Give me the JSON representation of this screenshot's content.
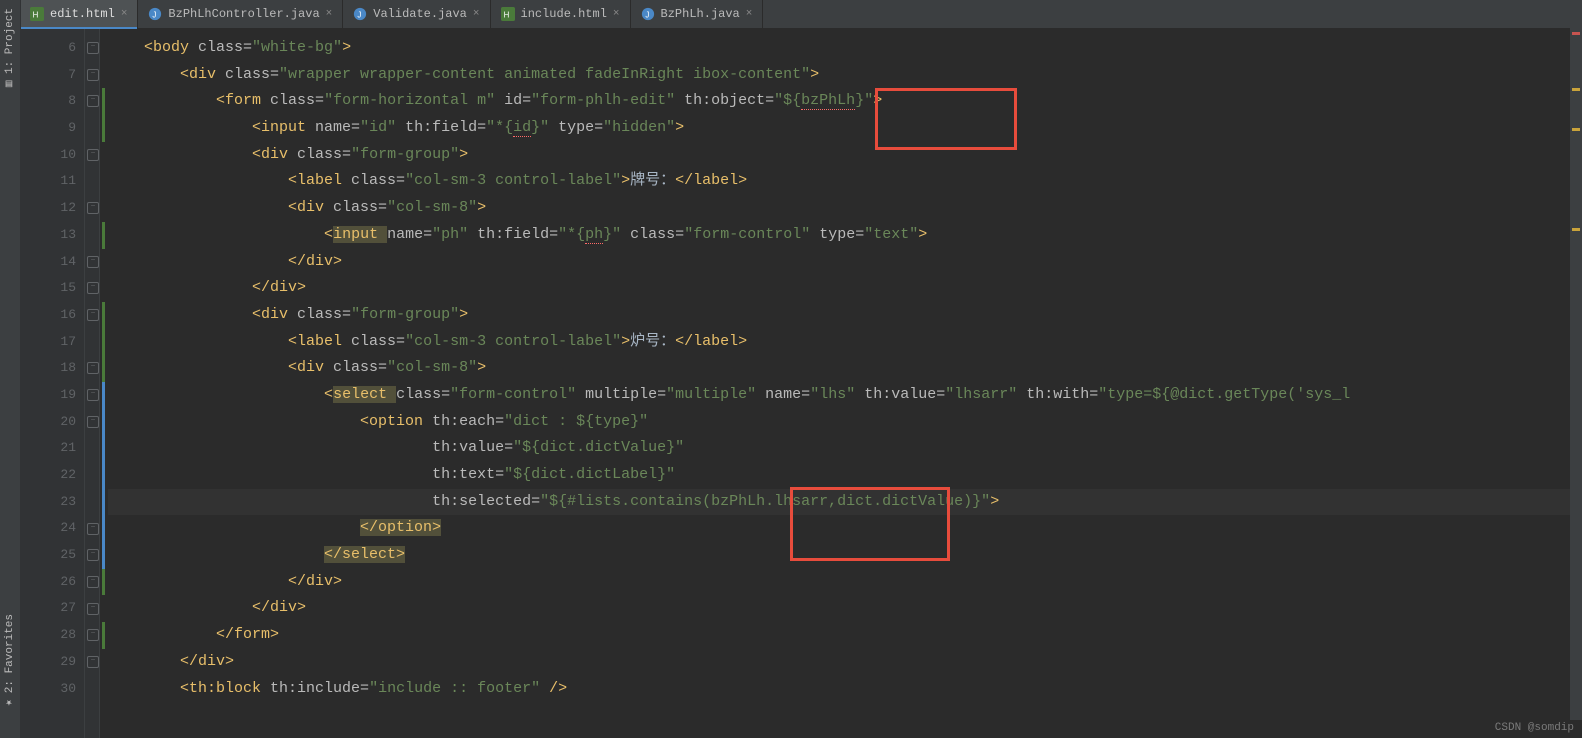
{
  "rail": {
    "project": "1: Project",
    "favorites": "2: Favorites"
  },
  "tabs": [
    {
      "label": "edit.html",
      "kind": "html",
      "active": true
    },
    {
      "label": "BzPhLhController.java",
      "kind": "java",
      "active": false
    },
    {
      "label": "Validate.java",
      "kind": "java",
      "active": false
    },
    {
      "label": "include.html",
      "kind": "html",
      "active": false
    },
    {
      "label": "BzPhLh.java",
      "kind": "java",
      "active": false
    }
  ],
  "gutter_start": 6,
  "gutter_end": 30,
  "code": {
    "l6": {
      "indent": "    ",
      "open": "<body ",
      "a1": "class=",
      "v1": "\"white-bg\"",
      "close": ">"
    },
    "l7": {
      "indent": "        ",
      "open": "<div ",
      "a1": "class=",
      "v1": "\"wrapper wrapper-content animated fadeInRight ibox-content\"",
      "close": ">"
    },
    "l8": {
      "indent": "            ",
      "open": "<form ",
      "a1": "class=",
      "v1": "\"form-horizontal m\" ",
      "a2": "id=",
      "v2": "\"form-phlh-edit\" ",
      "a3": "th:object=",
      "v3": "\"${",
      "v3err": "bzPhLh",
      "v3b": "}\"",
      "close": ">"
    },
    "l9": {
      "indent": "                ",
      "open": "<input ",
      "a1": "name=",
      "v1": "\"id\" ",
      "a2": "th:field=",
      "v2": "\"*{",
      "v2err": "id",
      "v2b": "}\" ",
      "a3": "type=",
      "v3": "\"hidden\"",
      "close": ">"
    },
    "l10": {
      "indent": "                ",
      "open": "<div ",
      "a1": "class=",
      "v1": "\"form-group\"",
      "close": ">"
    },
    "l11": {
      "indent": "                    ",
      "open": "<label ",
      "a1": "class=",
      "v1": "\"col-sm-3 control-label\"",
      "mid": ">",
      "text": "牌号：",
      "close": "</label>"
    },
    "l12": {
      "indent": "                    ",
      "open": "<div ",
      "a1": "class=",
      "v1": "\"col-sm-8\"",
      "close": ">"
    },
    "l13": {
      "indent": "                        ",
      "open": "<",
      "openw": "input ",
      "a1": "name=",
      "v1": "\"ph\" ",
      "a2": "th:field=",
      "v2": "\"*{",
      "v2err": "ph",
      "v2b": "}\" ",
      "a3": "class=",
      "v3": "\"form-control\" ",
      "a4": "type=",
      "v4": "\"text\"",
      "close": ">"
    },
    "l14": {
      "indent": "                    ",
      "close": "</div>"
    },
    "l15": {
      "indent": "                ",
      "close": "</div>"
    },
    "l16": {
      "indent": "                ",
      "open": "<div ",
      "a1": "class=",
      "v1": "\"form-group\"",
      "close": ">"
    },
    "l17": {
      "indent": "                    ",
      "open": "<label ",
      "a1": "class=",
      "v1": "\"col-sm-3 control-label\"",
      "mid": ">",
      "text": "炉号：",
      "close": "</label>"
    },
    "l18": {
      "indent": "                    ",
      "open": "<div ",
      "a1": "class=",
      "v1": "\"col-sm-8\"",
      "close": ">"
    },
    "l19": {
      "indent": "                        ",
      "open": "<",
      "openw": "select ",
      "a1": "class=",
      "v1": "\"form-control\" ",
      "a2": "multiple=",
      "v2": "\"multiple\" ",
      "a3": "name=",
      "v3": "\"lhs\" ",
      "a4": "th:value=",
      "v4": "\"lhsarr\" ",
      "a5": "th:with=",
      "v5": "\"type=",
      "v5b": "${",
      "v5c": "@dict.getType('sys_l"
    },
    "l20": {
      "indent": "                            ",
      "open": "<option ",
      "a1": "th:each=",
      "v1": "\"dict : ${type}\""
    },
    "l21": {
      "indent": "                                    ",
      "a1": "th:value=",
      "v1": "\"${dict.dictValue}\""
    },
    "l22": {
      "indent": "                                    ",
      "a1": "th:text=",
      "v1": "\"${dict.dictLabel}\""
    },
    "l23": {
      "indent": "                                    ",
      "a1": "th:selected=",
      "v1": "\"${#lists.contains(",
      "v1b": "bzPhLh.lhsarr,",
      "v1c": "dict.dictValue)}\"",
      "close": ">"
    },
    "l24": {
      "indent": "                            ",
      "close": "</option>"
    },
    "l25": {
      "indent": "                        ",
      "close": "</select>"
    },
    "l26": {
      "indent": "                    ",
      "close": "</div>"
    },
    "l27": {
      "indent": "                ",
      "close": "</div>"
    },
    "l28": {
      "indent": "            ",
      "close": "</form>"
    },
    "l29": {
      "indent": "        ",
      "close": "</div>"
    },
    "l30": {
      "indent": "        ",
      "open": "<th:block ",
      "a1": "th:include=",
      "v1": "\"include :: footer\" ",
      "close": "/>"
    }
  },
  "watermark": "CSDN @somdip"
}
